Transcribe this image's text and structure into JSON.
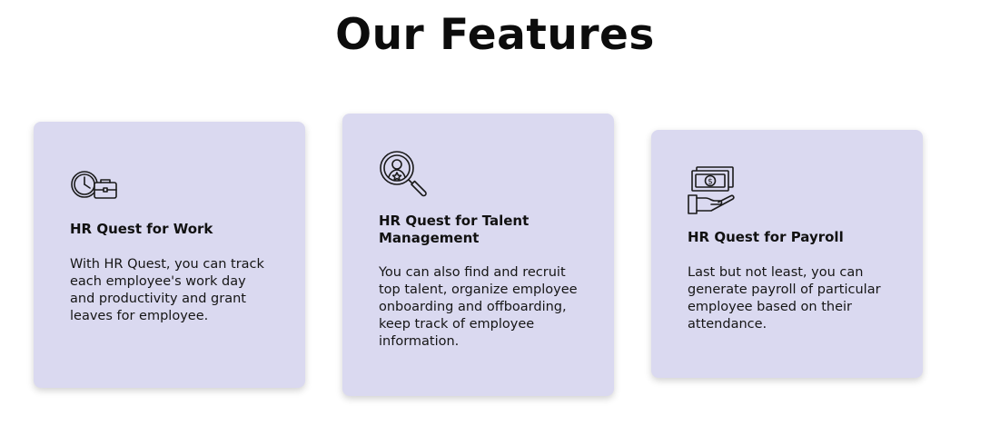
{
  "section": {
    "title": "Our Features"
  },
  "cards": [
    {
      "icon": "clock-briefcase-icon",
      "title": "HR Quest for Work",
      "description": "With HR Quest, you can track each employee's work day and productivity and grant leaves for employee."
    },
    {
      "icon": "talent-search-icon",
      "title": "HR Quest for Talent Management",
      "description": "You can also find and recruit top talent, organize employee onboarding and offboarding, keep track of employee information."
    },
    {
      "icon": "payroll-money-hand-icon",
      "title": "HR Quest for Payroll",
      "description": "Last but not least, you can generate payroll of particular employee based on their attendance."
    }
  ],
  "colors": {
    "card_background": "#dad9f0",
    "text": "#111111",
    "page_background": "#ffffff"
  }
}
